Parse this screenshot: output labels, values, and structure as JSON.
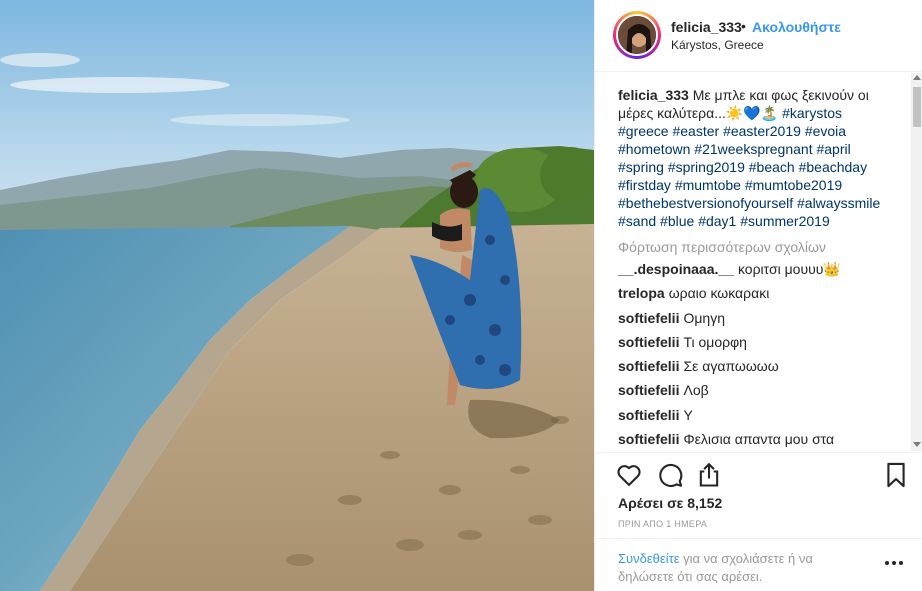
{
  "post": {
    "username": "felicia_333",
    "separator": "•",
    "follow_label": "Ακολουθήστε",
    "location": "Kárystos, Greece",
    "photo_alt": "Woman on a sandy beach holding a blue sarong"
  },
  "caption": {
    "user": "felicia_333",
    "text": "Με μπλε και φως ξεκινούν οι μέρες καλύτερα...☀️💙🏝️",
    "hashtags": [
      "#karystos",
      "#greece",
      "#easter",
      "#easter2019",
      "#evoia",
      "#hometown",
      "#21weekspregnant",
      "#april",
      "#spring",
      "#spring2019",
      "#beach",
      "#beachday",
      "#firstday",
      "#mumtobe",
      "#mumtobe2019",
      "#bethebestversionofyourself",
      "#alwayssmile",
      "#sand",
      "#blue",
      "#day1",
      "#summer2019"
    ]
  },
  "load_more_label": "Φόρτωση περισσότερων σχολίων",
  "comments": [
    {
      "user": "__.despoinaaa.__",
      "text": "κοριτσι μουυυ👑"
    },
    {
      "user": "trelopa",
      "text": "ωραιο κωκαρακι"
    },
    {
      "user": "softiefelii",
      "text": "Ομηγη"
    },
    {
      "user": "softiefelii",
      "text": "Τι ομορφη"
    },
    {
      "user": "softiefelii",
      "text": "Σε αγαπωωωω"
    },
    {
      "user": "softiefelii",
      "text": "Λοβ"
    },
    {
      "user": "softiefelii",
      "text": "Υ"
    },
    {
      "user": "softiefelii",
      "text": "Φελισια απαντα μου στα"
    }
  ],
  "likes_label": "Αρέσει σε 8,152",
  "time_label": "ΠΡΙΝ ΑΠΟ 1 ΗΜΕΡΑ",
  "login": {
    "link": "Συνδεθείτε",
    "text": " για να σχολιάσετε ή να δηλώσετε ότι σας αρέσει."
  },
  "icons": {
    "like": "heart-icon",
    "comment": "comment-icon",
    "share": "share-icon",
    "save": "bookmark-icon",
    "more": "more-options-icon"
  },
  "colors": {
    "link_blue": "#3897f0",
    "hashtag": "#003569",
    "muted": "#999999",
    "text": "#262626"
  }
}
